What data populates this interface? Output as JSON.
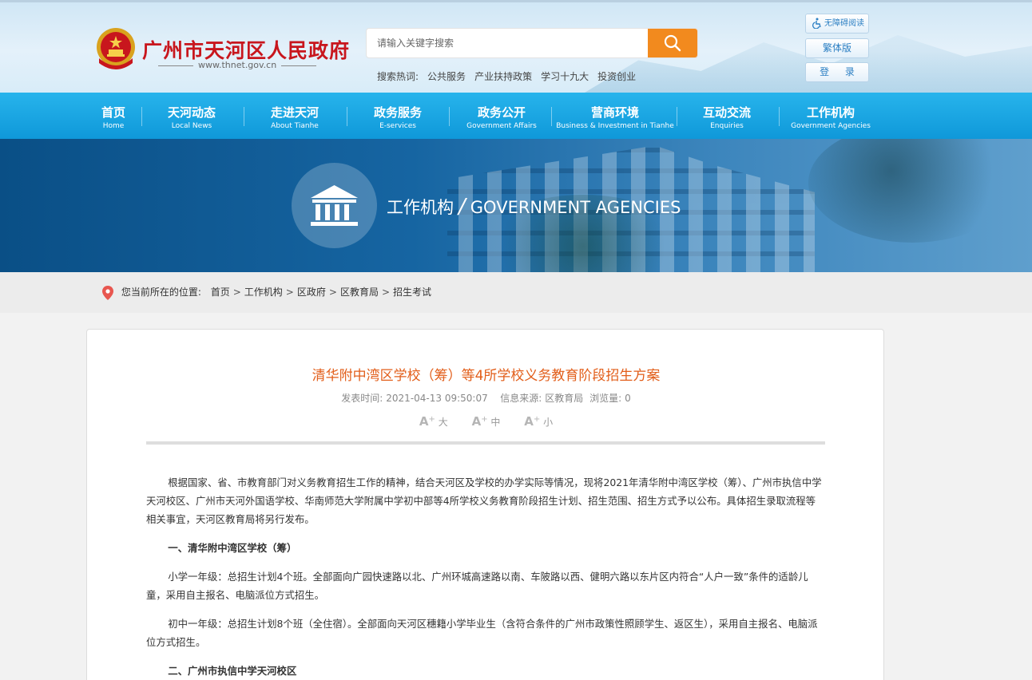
{
  "header": {
    "site_name": "广州市天河区人民政府",
    "site_url": "www.thnet.gov.cn",
    "search_placeholder": "请输入关键字搜索",
    "hot_label": "搜索热词:",
    "hot_words": [
      "公共服务",
      "产业扶持政策",
      "学习十九大",
      "投资创业"
    ],
    "accessibility_label": "无障碍阅读",
    "traditional_label": "繁体版",
    "login_label": "登 录"
  },
  "nav": [
    {
      "cn": "首页",
      "en": "Home"
    },
    {
      "cn": "天河动态",
      "en": "Local News"
    },
    {
      "cn": "走进天河",
      "en": "About Tianhe"
    },
    {
      "cn": "政务服务",
      "en": "E-services"
    },
    {
      "cn": "政务公开",
      "en": "Government Affairs"
    },
    {
      "cn": "营商环境",
      "en": "Business & Investment in Tianhe"
    },
    {
      "cn": "互动交流",
      "en": "Enquiries"
    },
    {
      "cn": "工作机构",
      "en": "Government Agencies"
    }
  ],
  "banner": {
    "title_cn": "工作机构",
    "slash": "/",
    "title_en": "GOVERNMENT AGENCIES"
  },
  "breadcrumb": {
    "label": "您当前所在的位置:",
    "items": [
      "首页",
      "工作机构",
      "区政府",
      "区教育局",
      "招生考试"
    ],
    "sep": ">"
  },
  "article": {
    "title": "清华附中湾区学校（筹）等4所学校义务教育阶段招生方案",
    "meta": {
      "time_label": "发表时间:",
      "time": "2021-04-13 09:50:07",
      "source_label": "信息来源:",
      "source": "区教育局",
      "views_label": "浏览量:",
      "views": "0"
    },
    "font_sizes": {
      "glyph": "A",
      "plus": "+",
      "large": "大",
      "medium": "中",
      "small": "小"
    },
    "paragraphs": [
      "根据国家、省、市教育部门对义务教育招生工作的精神，结合天河区及学校的办学实际等情况，现将2021年清华附中湾区学校（筹）、广州市执信中学天河校区、广州市天河外国语学校、华南师范大学附属中学初中部等4所学校义务教育阶段招生计划、招生范围、招生方式予以公布。具体招生录取流程等相关事宜，天河区教育局将另行发布。",
      "一、清华附中湾区学校（筹）",
      "小学一年级：总招生计划4个班。全部面向广园快速路以北、广州环城高速路以南、车陂路以西、健明六路以东片区内符合“人户一致”条件的适龄儿童，采用自主报名、电脑派位方式招生。",
      "初中一年级：总招生计划8个班（全住宿）。全部面向天河区穗籍小学毕业生（含符合条件的广州市政策性照顾学生、返区生），采用自主报名、电脑派位方式招生。",
      "二、广州市执信中学天河校区"
    ]
  },
  "colors": {
    "nav_blue": "#0f98d9",
    "title_orange": "#e25e1a",
    "brand_red": "#c8161d",
    "search_orange": "#f28a1e"
  },
  "icons": [
    "national-emblem-icon",
    "search-icon",
    "wheelchair-icon",
    "institution-building-icon",
    "location-pin-icon"
  ]
}
